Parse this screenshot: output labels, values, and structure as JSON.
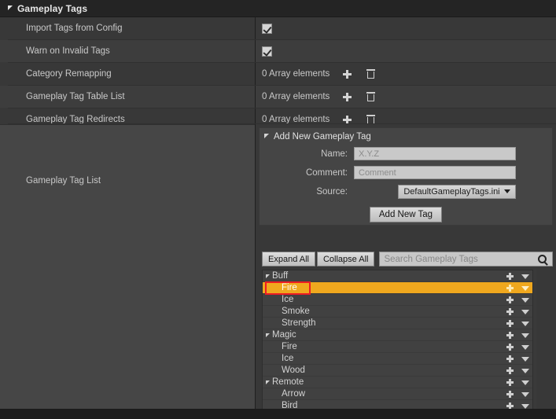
{
  "category": {
    "title": "Gameplay Tags",
    "expander_icon": "triangle-down-icon"
  },
  "properties": [
    {
      "label": "Import Tags from Config",
      "type": "checkbox",
      "checked": true
    },
    {
      "label": "Warn on Invalid Tags",
      "type": "checkbox",
      "checked": true
    },
    {
      "label": "Category Remapping",
      "type": "array",
      "value": "0 Array elements"
    },
    {
      "label": "Gameplay Tag Table List",
      "type": "array",
      "value": "0 Array elements"
    },
    {
      "label": "Gameplay Tag Redirects",
      "type": "array",
      "value": "0 Array elements"
    }
  ],
  "array_actions": {
    "add_icon": "plus-icon",
    "delete_icon": "trash-icon"
  },
  "tag_list_row": {
    "label": "Gameplay Tag List"
  },
  "add_new_tag": {
    "title": "Add New Gameplay Tag",
    "expander_icon": "triangle-down-icon",
    "name_label": "Name:",
    "name_value": "",
    "name_placeholder": "X.Y.Z",
    "comment_label": "Comment:",
    "comment_value": "",
    "comment_placeholder": "Comment",
    "source_label": "Source:",
    "source_value": "DefaultGameplayTags.ini",
    "source_caret_icon": "caret-down-icon",
    "submit_label": "Add New Tag"
  },
  "tree_toolbar": {
    "expand_all_label": "Expand All",
    "collapse_all_label": "Collapse All",
    "search_value": "",
    "search_placeholder": "Search Gameplay Tags",
    "search_icon": "magnifier-icon"
  },
  "tag_tree": {
    "row_add_icon": "plus-icon",
    "row_menu_icon": "caret-down-icon",
    "selected_tag": "Fire",
    "highlight_color": "#f0a81e",
    "annotation_color": "#ed1c24",
    "rows": [
      {
        "label": "Buff",
        "depth": 0,
        "expandable": true,
        "selected": false
      },
      {
        "label": "Fire",
        "depth": 1,
        "expandable": false,
        "selected": true
      },
      {
        "label": "Ice",
        "depth": 1,
        "expandable": false,
        "selected": false
      },
      {
        "label": "Smoke",
        "depth": 1,
        "expandable": false,
        "selected": false
      },
      {
        "label": "Strength",
        "depth": 1,
        "expandable": false,
        "selected": false
      },
      {
        "label": "Magic",
        "depth": 0,
        "expandable": true,
        "selected": false
      },
      {
        "label": "Fire",
        "depth": 1,
        "expandable": false,
        "selected": false
      },
      {
        "label": "Ice",
        "depth": 1,
        "expandable": false,
        "selected": false
      },
      {
        "label": "Wood",
        "depth": 1,
        "expandable": false,
        "selected": false
      },
      {
        "label": "Remote",
        "depth": 0,
        "expandable": true,
        "selected": false
      },
      {
        "label": "Arrow",
        "depth": 1,
        "expandable": false,
        "selected": false
      },
      {
        "label": "Bird",
        "depth": 1,
        "expandable": false,
        "selected": false
      }
    ]
  },
  "colors": {
    "panel_bg": "#383838",
    "header_bg": "#242424",
    "row_alt_bg": "#3d3d3d",
    "left_lower_bg": "#464646",
    "text": "#c9c9c9",
    "accent": "#f0a81e"
  }
}
